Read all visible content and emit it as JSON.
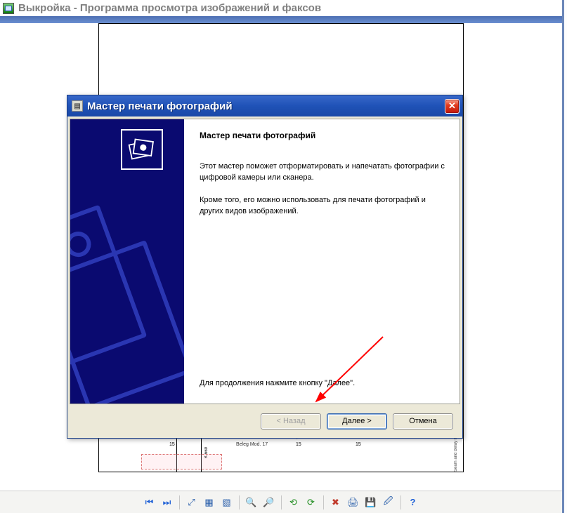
{
  "viewer": {
    "title": "Выкройка - Программа просмотра изображений и факсов"
  },
  "page": {
    "beleg": "Beleg Mod. 17",
    "seam": "Seam and Belay M",
    "ktext": "K 669",
    "num15": "15"
  },
  "wizard": {
    "title": "Мастер печати фотографий",
    "heading": "Мастер печати фотографий",
    "para1": "Этот мастер поможет отформатировать и напечатать фотографии с цифровой камеры или сканера.",
    "para2": "Кроме того, его можно использовать для печати фотографий и других видов изображений.",
    "continue": "Для продолжения нажмите кнопку \"Далее\".",
    "back": "< Назад",
    "next": "Далее >",
    "cancel": "Отмена"
  },
  "toolbar": {
    "first": "⏮",
    "next": "⏭",
    "fit": "⤢",
    "actual": "▦",
    "slideshow": "▧",
    "zoomin": "🔍",
    "zoomout": "🔎",
    "rotleft": "⟲",
    "rotright": "⟳",
    "delete": "✖",
    "print": "🖨",
    "save": "💾",
    "edit": "🖉",
    "help": "?"
  }
}
